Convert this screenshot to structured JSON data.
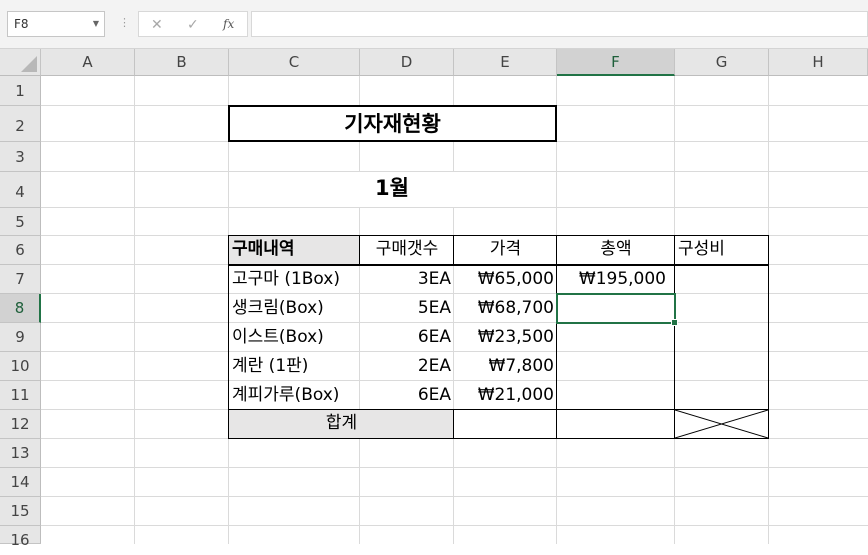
{
  "formula_bar": {
    "name_box": "F8",
    "formula": "",
    "cancel_icon": "x-icon",
    "enter_icon": "check-icon",
    "function_label": "fx"
  },
  "columns": [
    "A",
    "B",
    "C",
    "D",
    "E",
    "F",
    "G",
    "H"
  ],
  "rows": [
    "1",
    "2",
    "3",
    "4",
    "5",
    "6",
    "7",
    "8",
    "9",
    "10",
    "11",
    "12",
    "13",
    "14",
    "15",
    "16"
  ],
  "selected_cell": "F8",
  "sheet": {
    "title": "기자재현황",
    "month": "1월",
    "headers": [
      "구매내역",
      "구매갯수",
      "가격",
      "총액",
      "구성비"
    ],
    "items": [
      {
        "name": "고구마 (1Box)",
        "qty": "3EA",
        "price": "₩65,000",
        "total": "₩195,000"
      },
      {
        "name": "생크림(Box)",
        "qty": "5EA",
        "price": "₩68,700",
        "total": ""
      },
      {
        "name": "이스트(Box)",
        "qty": "6EA",
        "price": "₩23,500",
        "total": ""
      },
      {
        "name": "계란 (1판)",
        "qty": "2EA",
        "price": "₩7,800",
        "total": ""
      },
      {
        "name": "계피가루(Box)",
        "qty": "6EA",
        "price": "₩21,000",
        "total": ""
      }
    ],
    "total_label": "합계"
  },
  "colors": {
    "selection": "#217346",
    "header_fill": "#e7e6e6"
  }
}
